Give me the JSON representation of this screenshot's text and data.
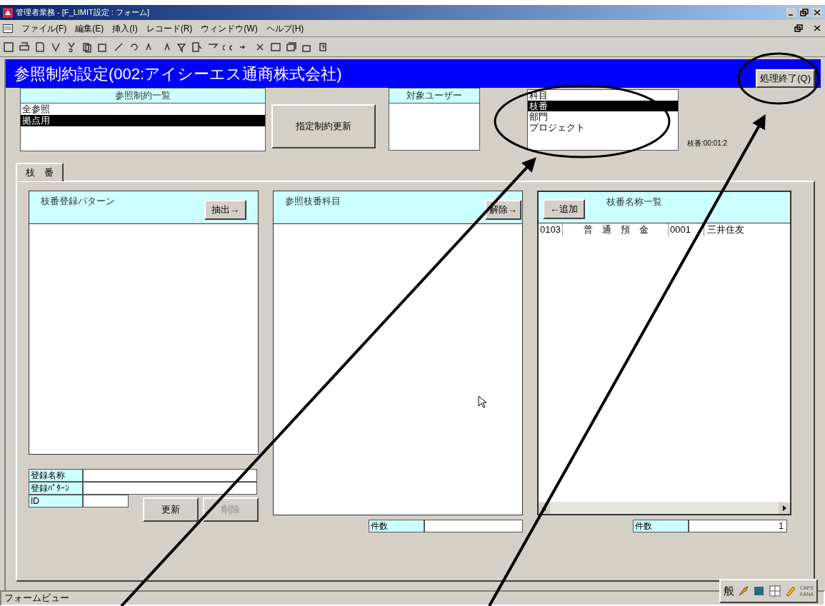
{
  "window": {
    "title": "管理者業務 - [F_LIMIT設定 : フォーム]"
  },
  "menu": [
    "ファイル(F)",
    "編集(E)",
    "挿入(I)",
    "レコード(R)",
    "ウィンドウ(W)",
    "ヘルプ(H)"
  ],
  "header": {
    "title": "参照制約設定(002:アイシーエス通商株式会社)",
    "close_button": "処理終了(Q)"
  },
  "constraint_list": {
    "title": "参照制約一覧",
    "items": [
      {
        "label": "全参照",
        "selected": false
      },
      {
        "label": "拠点用",
        "selected": true
      }
    ]
  },
  "update_button": "指定制約更新",
  "target_users": {
    "title": "対象ユーザー"
  },
  "category_list": {
    "items": [
      {
        "label": "科目",
        "selected": false
      },
      {
        "label": "枝番",
        "selected": true
      },
      {
        "label": "部門",
        "selected": false
      },
      {
        "label": "プロジェクト",
        "selected": false
      }
    ]
  },
  "code_label": "枝番:00:01:2",
  "tabs": [
    {
      "label": "枝　番",
      "selected": true
    }
  ],
  "pattern_panel": {
    "title": "枝番登録パターン",
    "button": "抽出→",
    "fields": [
      {
        "label": "登録名称"
      },
      {
        "label": "登録ﾊﾟﾀｰﾝ"
      },
      {
        "label": "ID"
      }
    ],
    "buttons": [
      {
        "label": "更新",
        "disabled": false
      },
      {
        "label": "削除",
        "disabled": true
      }
    ]
  },
  "reference_panel": {
    "title": "参照枝番科目",
    "button": "解除→",
    "count_label": "件数"
  },
  "name_panel": {
    "title": "枝番名称一覧",
    "button": "←追加",
    "rows": [
      [
        "0103",
        "普　通　預　金",
        "0001",
        "三井住友"
      ]
    ],
    "count_label": "件数",
    "count": "1"
  },
  "status_bar": {
    "text": "フォームビュー"
  },
  "ime_bar": {
    "mode": "般",
    "caps": "CAPS",
    "kana": "KANA"
  }
}
